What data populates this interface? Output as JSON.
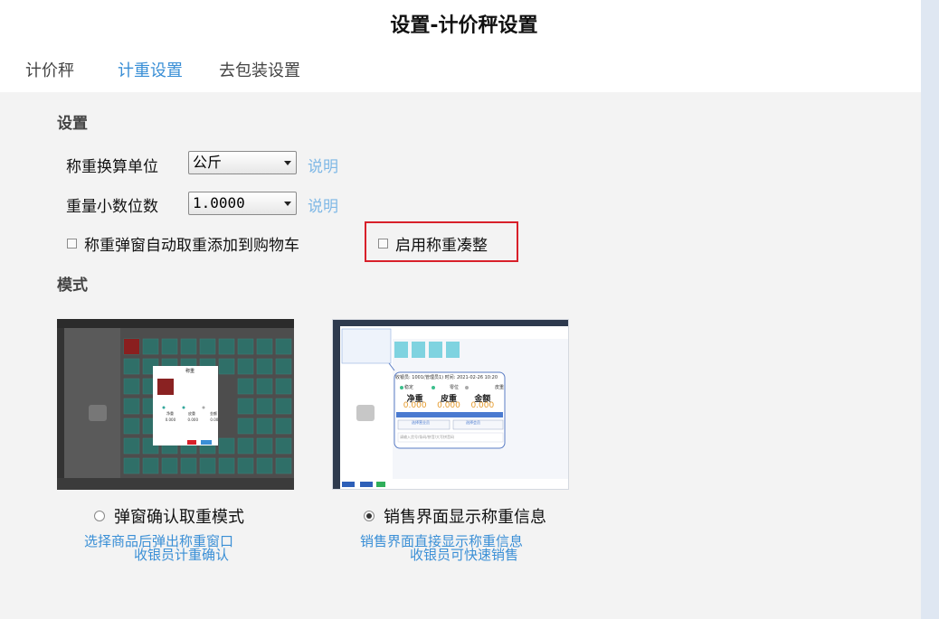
{
  "window": {
    "title": "设置-计价秤设置"
  },
  "tabs": [
    {
      "label": "计价秤",
      "active": false
    },
    {
      "label": "计重设置",
      "active": true
    },
    {
      "label": "去包装设置",
      "active": false
    }
  ],
  "settings": {
    "section_title": "设置",
    "unit": {
      "label": "称重换算单位",
      "value": "公斤",
      "help": "说明"
    },
    "decimals": {
      "label": "重量小数位数",
      "value": "1.0000",
      "help": "说明"
    },
    "auto_add": {
      "label": "称重弹窗自动取重添加到购物车",
      "checked": false
    },
    "rounding": {
      "label": "启用称重凑整",
      "checked": false
    }
  },
  "mode": {
    "section_title": "模式",
    "popup": {
      "label": "弹窗确认取重模式",
      "selected": false,
      "desc_line1": "选择商品后弹出称重窗口",
      "desc_line2": "收银员计重确认",
      "preview": {
        "dialog_title": "称重",
        "col_labels": [
          "净重",
          "皮重",
          "金额"
        ],
        "col_values": [
          "0.000",
          "0.000",
          "0.00"
        ]
      }
    },
    "inline": {
      "label": "销售界面显示称重信息",
      "selected": true,
      "desc_line1": "销售界面直接显示称重信息",
      "desc_line2": "收银员可快速销售",
      "preview": {
        "status_line": "收银员: 1001(管理员1)    时间: 2021-02-26 10:20",
        "status_items": [
          "稳定",
          "零位",
          "皮重"
        ],
        "col_labels": [
          "净重",
          "皮重",
          "金额"
        ],
        "col_values": [
          "0.000",
          "0.000",
          "0.000"
        ],
        "member_btn": "选择营业员",
        "member_btn2": "选择会员",
        "search_placeholder": "请输入货号/条码/拼音/大写拼音码"
      }
    }
  },
  "colors": {
    "accent": "#3a8fd6",
    "help_link": "#7fb8e6",
    "highlight": "#d8202a",
    "tile": "#35a89c"
  }
}
